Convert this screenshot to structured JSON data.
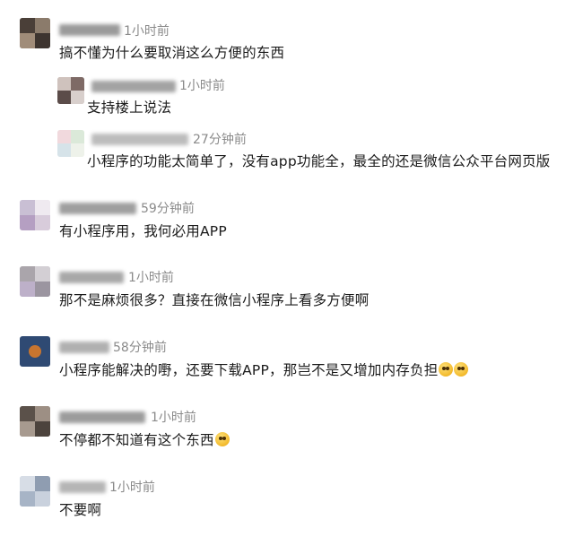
{
  "comments": [
    {
      "time": "1小时前",
      "text": "搞不懂为什么要取消这么方便的东西"
    },
    {
      "time": "1小时前",
      "text": "支持楼上说法"
    },
    {
      "time": "27分钟前",
      "text": "小程序的功能太简单了，没有app功能全，最全的还是微信公众平台网页版"
    },
    {
      "time": "59分钟前",
      "text": "有小程序用，我何必用APP"
    },
    {
      "time": "1小时前",
      "text": "那不是麻烦很多？直接在微信小程序上看多方便啊"
    },
    {
      "time": "58分钟前",
      "text": "小程序能解决的嘢，还要下载APP，那岂不是又增加内存负担"
    },
    {
      "time": "1小时前",
      "text": "不停都不知道有这个东西"
    },
    {
      "time": "1小时前",
      "text": "不要啊"
    }
  ],
  "icons": {
    "emoji": "dizzy-face-emoji",
    "emoji_laugh": "laughing-emoji"
  }
}
